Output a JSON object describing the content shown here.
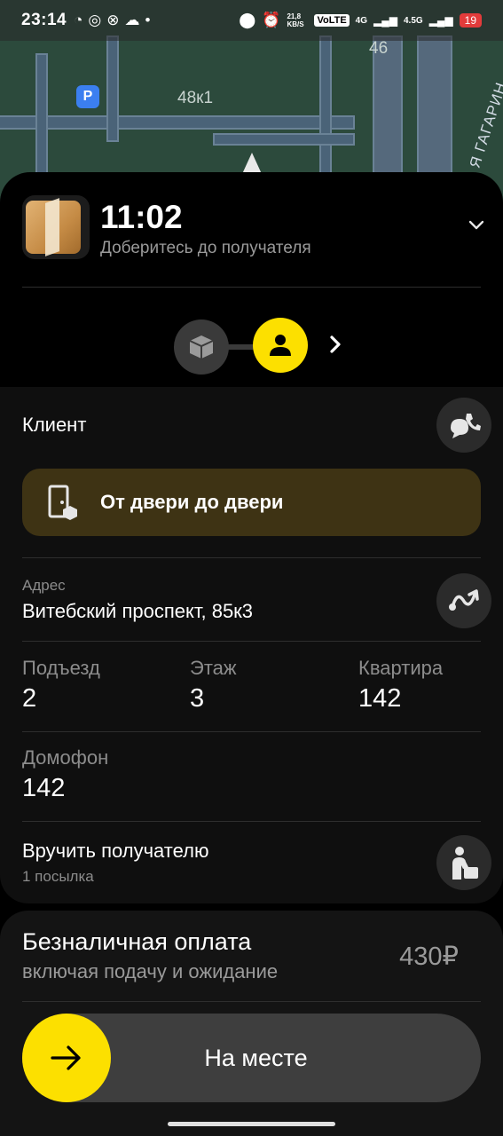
{
  "status_bar": {
    "time": "23:14",
    "net_speed": "21,8 KB/S",
    "volte": "VoLTE",
    "sim1": "4G",
    "sim2": "4.5G",
    "battery": "19"
  },
  "map": {
    "building_label": "48к1",
    "house_label": "46",
    "street_label": "Я ГАГАРИН",
    "parking_label": "P"
  },
  "header": {
    "eta": "11:02",
    "subtitle": "Доберитесь до получателя"
  },
  "client": {
    "title": "Клиент"
  },
  "delivery_option": {
    "label": "От двери до двери"
  },
  "address": {
    "label": "Адрес",
    "value": "Витебский проспект, 85к3"
  },
  "details": {
    "entrance_label": "Подъезд",
    "entrance_value": "2",
    "floor_label": "Этаж",
    "floor_value": "3",
    "apartment_label": "Квартира",
    "apartment_value": "142",
    "intercom_label": "Домофон",
    "intercom_value": "142"
  },
  "handover": {
    "title": "Вручить получателю",
    "subtitle": "1 посылка"
  },
  "payment": {
    "title": "Безналичная оплата",
    "subtitle": "включая подачу и ожидание",
    "price": "430₽"
  },
  "action": {
    "label": "На месте"
  },
  "colors": {
    "accent": "#fce000",
    "door_pill": "#3e3314",
    "card": "#0f0f0f"
  }
}
